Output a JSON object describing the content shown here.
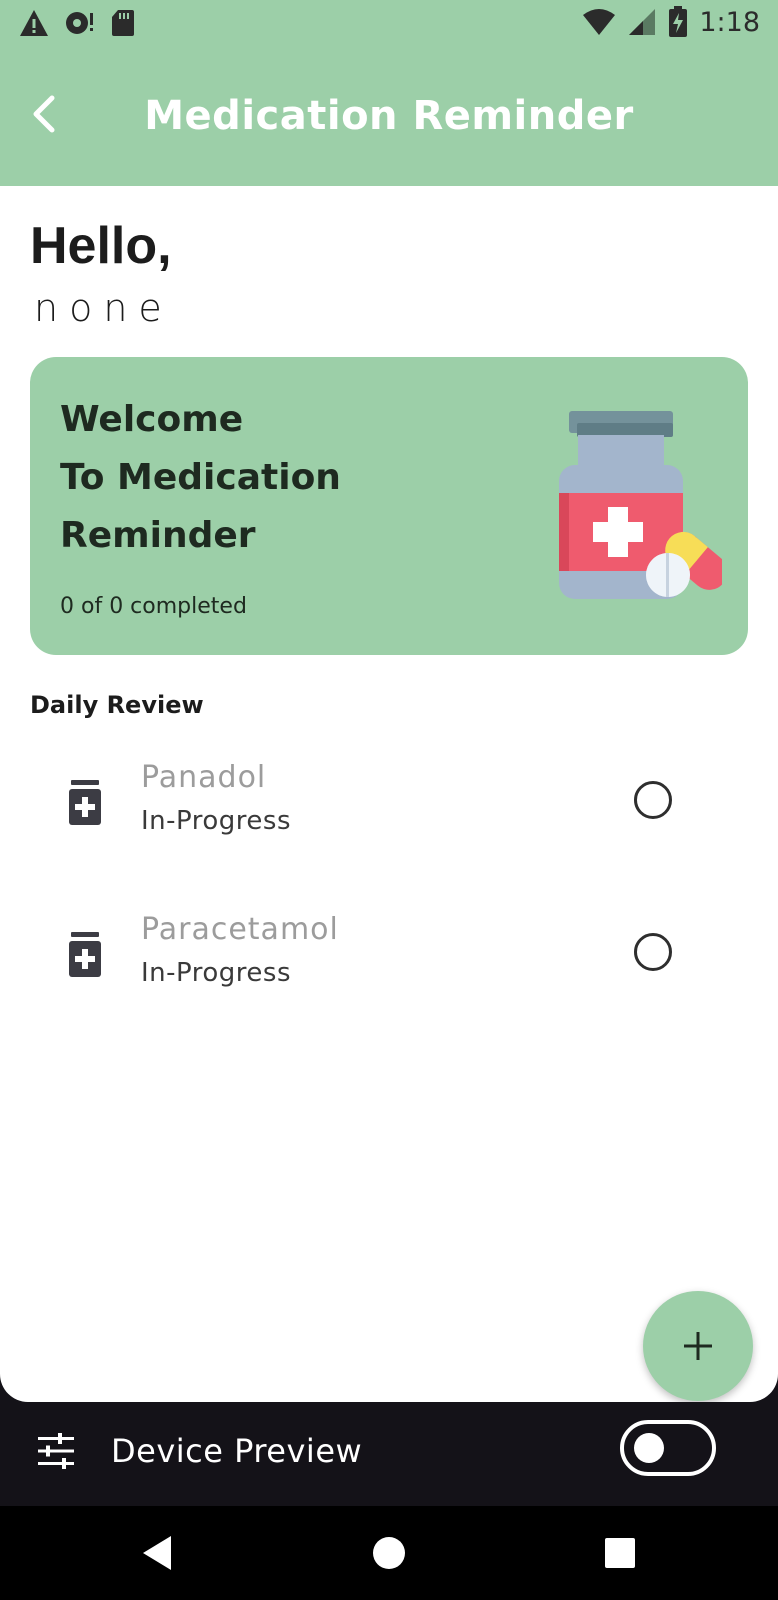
{
  "status_bar": {
    "time": "1:18",
    "left_icons": [
      "warning-icon",
      "sync-icon",
      "sd-card-icon"
    ],
    "right_icons": [
      "wifi-icon",
      "signal-icon",
      "battery-icon"
    ]
  },
  "app_bar": {
    "title": "Medication Reminder",
    "back_icon": "chevron-left-icon"
  },
  "greeting": {
    "hello": "Hello,",
    "name": "none"
  },
  "welcome_card": {
    "title": "Welcome\nTo Medication\nReminder",
    "progress": "0 of 0 completed",
    "illustration": "medicine-bottle-illustration"
  },
  "daily_review": {
    "title": "Daily Review",
    "items": [
      {
        "name": "Panadol",
        "status": "In-Progress",
        "icon": "medication-icon",
        "checked": false
      },
      {
        "name": "Paracetamol",
        "status": "In-Progress",
        "icon": "medication-icon",
        "checked": false
      }
    ]
  },
  "fab": {
    "icon": "plus-icon"
  },
  "device_preview": {
    "label": "Device Preview",
    "icon": "tune-icon",
    "enabled": false
  },
  "nav_bar": {
    "buttons": [
      "back-nav",
      "home-nav",
      "recents-nav"
    ]
  },
  "colors": {
    "accent": "#9ccfa8",
    "pill_red": "#ef5b6e",
    "pill_yellow": "#f7dd57",
    "dark": "#141218"
  }
}
